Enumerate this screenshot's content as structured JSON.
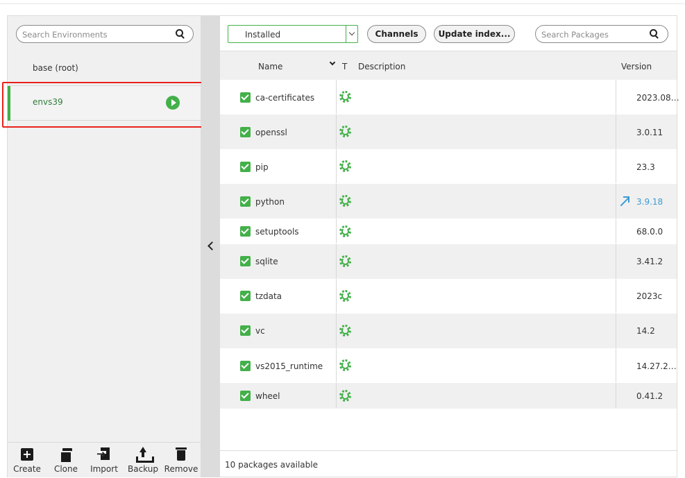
{
  "environments": {
    "search_placeholder": "Search Environments",
    "items": [
      {
        "name": "base (root)",
        "active": false
      },
      {
        "name": "envs39",
        "active": true
      }
    ],
    "actions": [
      {
        "label": "Create",
        "icon": "plus-box-icon"
      },
      {
        "label": "Clone",
        "icon": "clone-icon"
      },
      {
        "label": "Import",
        "icon": "import-icon"
      },
      {
        "label": "Backup",
        "icon": "upload-icon"
      },
      {
        "label": "Remove",
        "icon": "trash-icon"
      }
    ]
  },
  "toolbar": {
    "filter_value": "Installed",
    "filter_options": [
      "Installed"
    ],
    "channels_label": "Channels",
    "update_index_label": "Update index...",
    "search_placeholder": "Search Packages"
  },
  "table": {
    "columns": {
      "name": "Name",
      "type": "T",
      "description": "Description",
      "version": "Version"
    },
    "rows": [
      {
        "name": "ca-certificates",
        "version": "2023.08…",
        "checked": true,
        "upgradable": false
      },
      {
        "name": "openssl",
        "version": "3.0.11",
        "checked": true,
        "upgradable": false
      },
      {
        "name": "pip",
        "version": "23.3",
        "checked": true,
        "upgradable": false
      },
      {
        "name": "python",
        "version": "3.9.18",
        "checked": true,
        "upgradable": true
      },
      {
        "name": "setuptools",
        "version": "68.0.0",
        "checked": true,
        "upgradable": false
      },
      {
        "name": "sqlite",
        "version": "3.41.2",
        "checked": true,
        "upgradable": false
      },
      {
        "name": "tzdata",
        "version": "2023c",
        "checked": true,
        "upgradable": false
      },
      {
        "name": "vc",
        "version": "14.2",
        "checked": true,
        "upgradable": false
      },
      {
        "name": "vs2015_runtime",
        "version": "14.27.2…",
        "checked": true,
        "upgradable": false
      },
      {
        "name": "wheel",
        "version": "0.41.2",
        "checked": true,
        "upgradable": false
      }
    ]
  },
  "footer": {
    "status": "10 packages available"
  },
  "colors": {
    "accent": "#43b049",
    "upgrade": "#3a9bd5",
    "highlight": "#e8211b"
  }
}
